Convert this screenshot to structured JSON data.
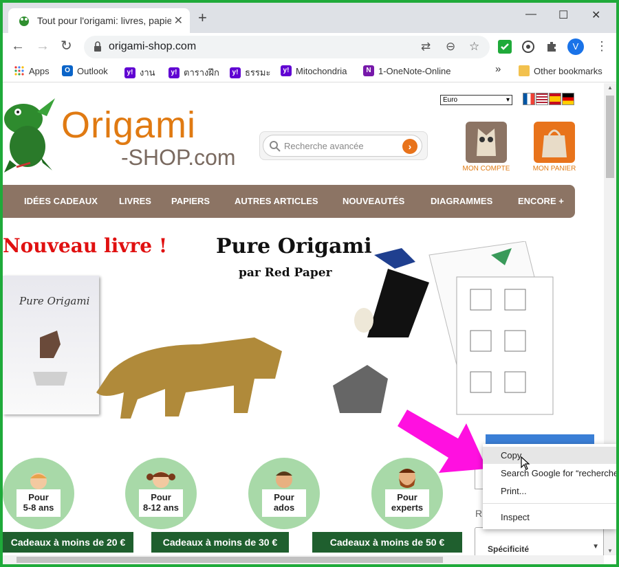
{
  "tab": {
    "title": "Tout pour l'origami: livres, papiers",
    "close": "✕",
    "new_tab": "+"
  },
  "window": {
    "minimize": "—",
    "maximize": "☐",
    "close": "✕"
  },
  "toolbar": {
    "back": "←",
    "forward": "→",
    "reload": "↻",
    "url": "origami-shop.com",
    "translate": "⇄",
    "zoom": "⊖",
    "star": "☆",
    "menu": "⋮",
    "profile": "V"
  },
  "bookmarks": {
    "items": [
      {
        "label": "Apps",
        "icon": "apps-grid-icon"
      },
      {
        "label": "Outlook",
        "icon": "outlook-icon"
      },
      {
        "label": "งาน",
        "icon": "yahoo-icon"
      },
      {
        "label": "ตารางฝึก",
        "icon": "yahoo-icon"
      },
      {
        "label": "ธรรมะ",
        "icon": "yahoo-icon"
      },
      {
        "label": "Mitochondria",
        "icon": "yahoo-icon"
      },
      {
        "label": "1-OneNote-Online",
        "icon": "onenote-icon"
      }
    ],
    "overflow": "»",
    "other": "Other bookmarks"
  },
  "site": {
    "logo_word": "Origami",
    "logo_shop": "-SHOP.com",
    "search_placeholder": "Recherche avancée",
    "search_go": "›",
    "currency": "Euro",
    "account_label": "MON COMPTE",
    "cart_label": "MON PANIER",
    "nav": [
      "IDÉES CADEAUX",
      "LIVRES",
      "PAPIERS",
      "AUTRES ARTICLES",
      "NOUVEAUTÉS",
      "DIAGRAMMES",
      "ENCORE +"
    ]
  },
  "hero": {
    "new_book": "Nouveau livre !",
    "title": "Pure Origami",
    "by": "par Red Paper",
    "cover_title": "Pure Origami"
  },
  "audiences": [
    {
      "line1": "Pour",
      "line2": "5-8 ans"
    },
    {
      "line1": "Pour",
      "line2": "8-12 ans"
    },
    {
      "line1": "Pour",
      "line2": "ados"
    },
    {
      "line1": "Pour",
      "line2": "experts"
    }
  ],
  "gifts": [
    "Cadeaux à moins de 20 €",
    "Cadeaux à moins de 30 €",
    "Cadeaux à moins de 50 €"
  ],
  "filter": {
    "letter": "R",
    "field_label": "Spécificité"
  },
  "context_menu": {
    "copy": "Copy",
    "search": "Search Google for “recherche",
    "print": "Print...",
    "inspect": "Inspect"
  },
  "colors": {
    "frame": "#1faa3a",
    "brand_orange": "#e07a12",
    "nav_brown": "#8c7464",
    "gift_green": "#1f5f2e",
    "arrow_magenta": "#ff10e0"
  }
}
